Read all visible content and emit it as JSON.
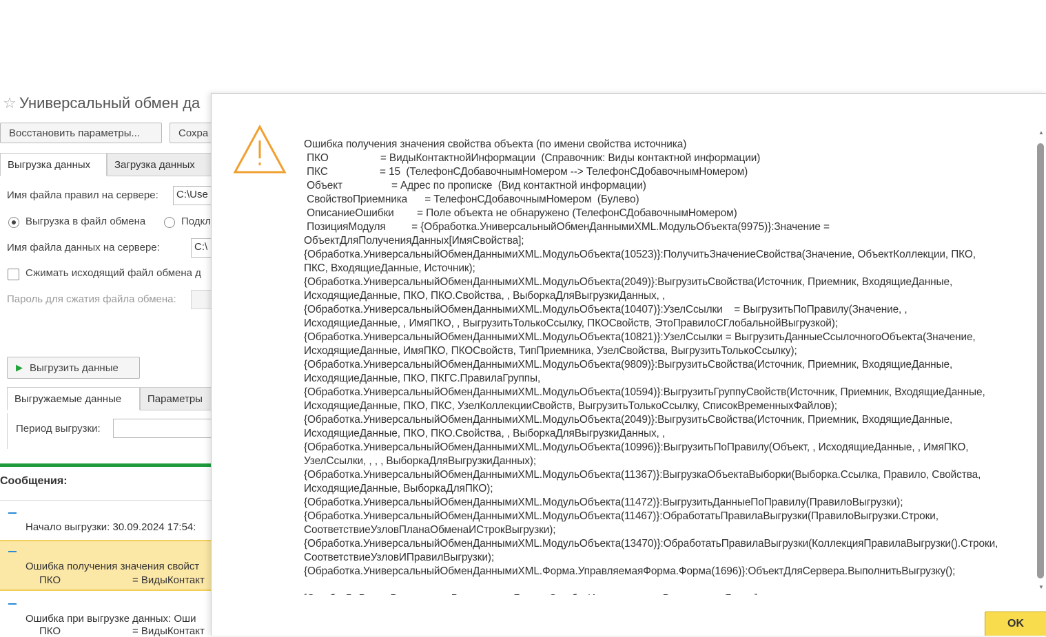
{
  "form": {
    "title": "Универсальный обмен да",
    "restore_button": "Восстановить параметры...",
    "save_button": "Сохра",
    "tabs": [
      "Выгрузка данных",
      "Загрузка данных"
    ],
    "rules_file_label": "Имя файла правил на сервере:",
    "rules_file_value": "C:\\Use",
    "export_to_file_radio": "Выгрузка в файл обмена",
    "connect_radio": "Подкл",
    "data_file_label": "Имя файла данных на сервере:",
    "data_file_value": "C:\\",
    "compress_checkbox": "Сжимать исходящий файл обмена д",
    "password_label": "Пароль для сжатия файла обмена:",
    "export_button": "Выгрузить данные",
    "inner_tabs": [
      "Выгружаемые данные",
      "Параметры"
    ],
    "period_label": "Период выгрузки:"
  },
  "messages": {
    "title": "Сообщения:",
    "items": [
      {
        "text": "Начало выгрузки: 30.09.2024 17:54:"
      },
      {
        "text": "Ошибка получения значения свойст",
        "sub_key": "ПКО",
        "sub_val": "= ВидыКонтакт"
      },
      {
        "text": "Ошибка при выгрузке данных: Оши",
        "sub_key": "ПКО",
        "sub_val": "= ВидыКонтакт"
      }
    ]
  },
  "dialog": {
    "icon": "warning-triangle-icon",
    "error_text": "Ошибка получения значения свойства объекта (по имени свойства источника)\n ПКО                  = ВидыКонтактнойИнформации  (Справочник: Виды контактной информации)\n ПКС                  = 15  (ТелефонСДобавочнымНомером --> ТелефонСДобавочнымНомером)\n Объект                 = Адрес по прописке  (Вид контактной информации)\n СвойствоПриемника      = ТелефонСДобавочнымНомером  (Булево)\n ОписаниеОшибки        = Поле объекта не обнаружено (ТелефонСДобавочнымНомером)\n ПозицияМодуля         = {Обработка.УниверсальныйОбменДаннымиXML.МодульОбъекта(9975)}:Значение = \nОбъектДляПолученияДанных[ИмяСвойства];\n{Обработка.УниверсальныйОбменДаннымиXML.МодульОбъекта(10523)}:ПолучитьЗначениеСвойства(Значение, ОбъектКоллекции, ПКО, \nПКС, ВходящиеДанные, Источник);\n{Обработка.УниверсальныйОбменДаннымиXML.МодульОбъекта(2049)}:ВыгрузитьСвойства(Источник, Приемник, ВходящиеДанные, \nИсходящиеДанные, ПКО, ПКО.Свойства, , ВыборкаДляВыгрузкиДанных, , \n{Обработка.УниверсальныйОбменДаннымиXML.МодульОбъекта(10407)}:УзелСсылки    = ВыгрузитьПоПравилу(Значение, , \nИсходящиеДанные, , ИмяПКО, , ВыгрузитьТолькоСсылку, ПКОСвойств, ЭтоПравилоСГлобальнойВыгрузкой);\n{Обработка.УниверсальныйОбменДаннымиXML.МодульОбъекта(10821)}:УзелСсылки = ВыгрузитьДанныеСсылочногоОбъекта(Значение, \nИсходящиеДанные, ИмяПКО, ПКОСвойств, ТипПриемника, УзелСвойства, ВыгрузитьТолькоСсылку);\n{Обработка.УниверсальныйОбменДаннымиXML.МодульОбъекта(9809)}:ВыгрузитьСвойства(Источник, Приемник, ВходящиеДанные, \nИсходящиеДанные, ПКО, ПКГС.ПравилаГруппы, \n{Обработка.УниверсальныйОбменДаннымиXML.МодульОбъекта(10594)}:ВыгрузитьГруппуСвойств(Источник, Приемник, ВходящиеДанные, \nИсходящиеДанные, ПКО, ПКС, УзелКоллекцииСвойств, ВыгрузитьТолькоСсылку, СписокВременныхФайлов);\n{Обработка.УниверсальныйОбменДаннымиXML.МодульОбъекта(2049)}:ВыгрузитьСвойства(Источник, Приемник, ВходящиеДанные, \nИсходящиеДанные, ПКО, ПКО.Свойства, , ВыборкаДляВыгрузкиДанных, , \n{Обработка.УниверсальныйОбменДаннымиXML.МодульОбъекта(10996)}:ВыгрузитьПоПравилу(Объект, , ИсходящиеДанные, , ИмяПКО, \nУзелСсылки, , , , ВыборкаДляВыгрузкиДанных);\n{Обработка.УниверсальныйОбменДаннымиXML.МодульОбъекта(11367)}:ВыгрузкаОбъектаВыборки(Выборка.Ссылка, Правило, Свойства, \nИсходящиеДанные, ВыборкаДляПКО);\n{Обработка.УниверсальныйОбменДаннымиXML.МодульОбъекта(11472)}:ВыгрузитьДанныеПоПравилу(ПравилоВыгрузки);\n{Обработка.УниверсальныйОбменДаннымиXML.МодульОбъекта(11467)}:ОбработатьПравилаВыгрузки(ПравилоВыгрузки.Строки, \nСоответствиеУзловПланаОбменаИСтрокВыгрузки);\n{Обработка.УниверсальныйОбменДаннымиXML.МодульОбъекта(13470)}:ОбработатьПравилаВыгрузки(КоллекцияПравилаВыгрузки().Строки, \nСоответствиеУзловИПравилВыгрузки);\n{Обработка.УниверсальныйОбменДаннымиXML.Форма.УправляемаяФорма.Форма(1696)}:ОбъектДляСервера.ВыполнитьВыгрузку();\n\n[ОшибкаВоВремяВыполненияВстроенногоЯзыка, ОшибкаИспользованияВстроенногоЯзыка]",
    "ok_button": "OK"
  },
  "colors": {
    "accent_green": "#1f9a3d",
    "selected_message_bg": "#fbe7a6",
    "ok_button_bg": "#f8dc4e",
    "warning_icon": "#f0a030"
  }
}
